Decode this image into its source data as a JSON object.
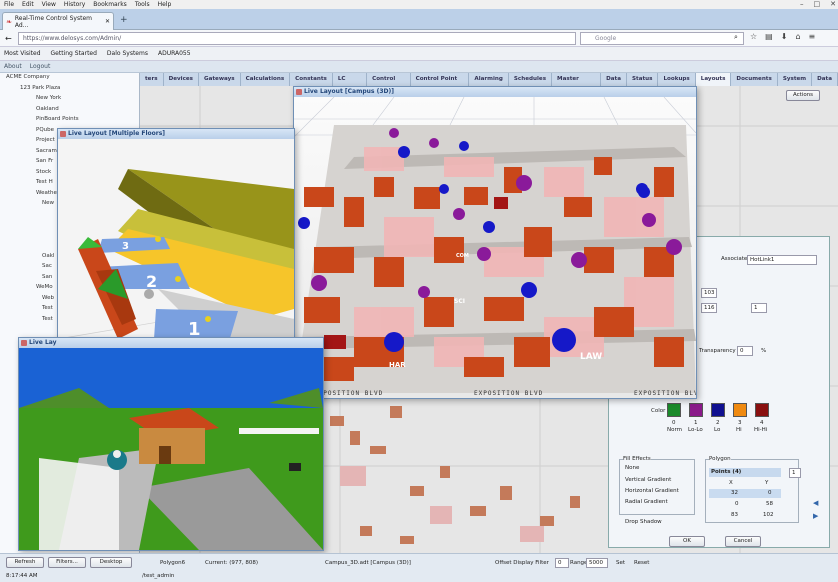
{
  "menu": [
    "File",
    "Edit",
    "View",
    "History",
    "Bookmarks",
    "Tools",
    "Help"
  ],
  "browser": {
    "tab_title": "Real-Time Control System Ad...",
    "url": "https://www.delosys.com/Admin/",
    "search_placeholder": "Google",
    "new_tab": "+"
  },
  "bookmarks": [
    "Most Visited",
    "Getting Started",
    "Dalo Systems",
    "ADURA055"
  ],
  "appbar": [
    "About",
    "Logout"
  ],
  "tree": [
    "ACME Company",
    "123 Park Plaza",
    "New York",
    "Oakland",
    "PinBoard Points",
    "PQube",
    "Project",
    "Sacram",
    "San Fr",
    "Stock",
    "Test H",
    "Weathe",
    "New",
    "",
    "",
    "",
    "",
    "Oakl",
    "Sac",
    "San",
    "WeMo",
    "Web",
    "Test",
    "Test"
  ],
  "tabs": [
    "ters",
    "Devices",
    "Gateways",
    "Calculations",
    "Constants",
    "LC Groups",
    "Control Points",
    "Control Point Groups",
    "Alarming",
    "Schedules",
    "Master Schedule",
    "Data",
    "Status",
    "Lookups",
    "Layouts",
    "Documents",
    "System",
    "Data"
  ],
  "active_tab": "Layouts",
  "actions": "Actions",
  "windows": {
    "campus": "Live Layout [Campus (3D)]",
    "floors": "Live Layout [Multiple Floors]",
    "house": "Live Lay"
  },
  "campus_labels": {
    "street": "EXPOSITION BLVD",
    "law": "LAW",
    "sci": "SCI",
    "har": "HAR",
    "com": "COM"
  },
  "floor_numbers": [
    "3",
    "2",
    "1"
  ],
  "dialog": {
    "associate_label": "Associate",
    "associate_value": "HotLink1",
    "val1": "103",
    "val2": "116",
    "val3": "1",
    "transparency_label": "Transparency",
    "transparency_value": "0",
    "transparency_unit": "%",
    "color_label": "Color",
    "colors": [
      {
        "num": "0",
        "name": "Norm",
        "hex": "#1a8a2a"
      },
      {
        "num": "1",
        "name": "Lo-Lo",
        "hex": "#8a1a8a"
      },
      {
        "num": "2",
        "name": "Lo",
        "hex": "#101090"
      },
      {
        "num": "3",
        "name": "Hi",
        "hex": "#f08a10"
      },
      {
        "num": "4",
        "name": "Hi-Hi",
        "hex": "#8a1010"
      }
    ],
    "fill_effects_label": "Fill Effects",
    "fill_options": [
      "None",
      "Vertical Gradient",
      "Horizontal Gradient",
      "Radial Gradient"
    ],
    "drop_shadow": "Drop Shadow",
    "polygon_label": "Polygon",
    "points_label": "Points (4)",
    "points_count": "1",
    "points_headers": [
      "X",
      "Y"
    ],
    "points_rows": [
      [
        "32",
        "0"
      ],
      [
        "0",
        "58"
      ],
      [
        "83",
        "102"
      ]
    ],
    "ok": "OK",
    "cancel": "Cancel"
  },
  "status": {
    "refresh": "Refresh",
    "filters": "Filters...",
    "desktop": "Desktop",
    "polygon": "Polygon6",
    "current": "Current: (977, 808)",
    "file": "Campus_3D.adt [Campus (3D)]",
    "offset": "Offset Display Filter",
    "offset_val": "0",
    "range": "Range",
    "range_val": "5000",
    "set": "Set",
    "reset": "Reset",
    "time": "8:17:44 AM",
    "path": "/test_admin"
  }
}
